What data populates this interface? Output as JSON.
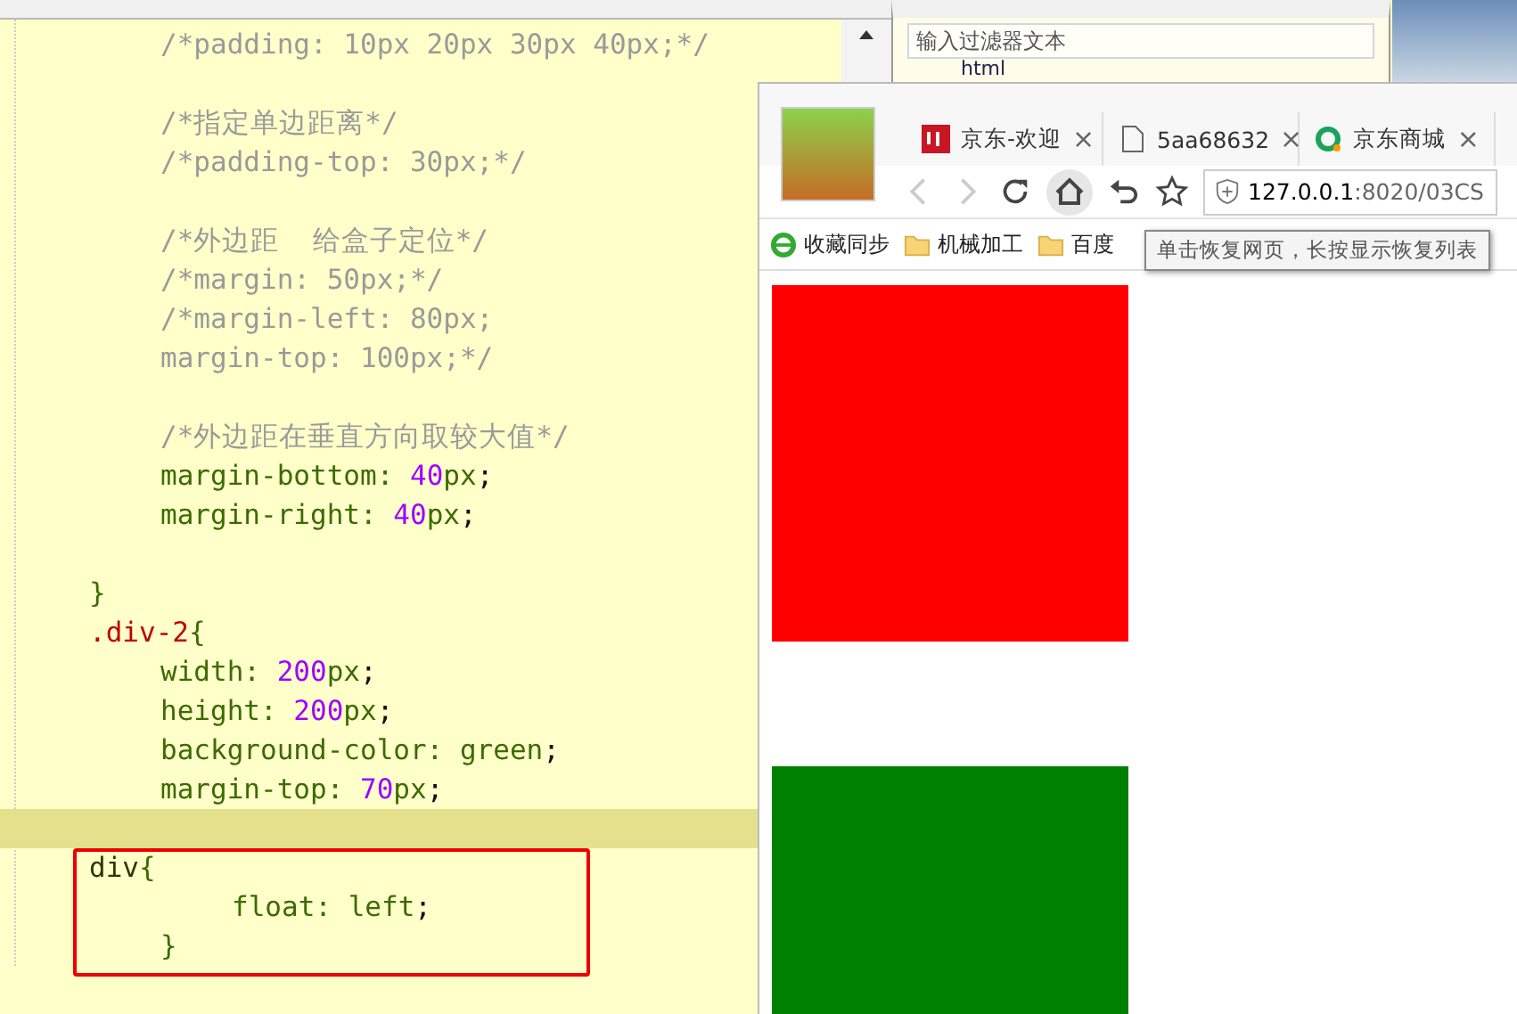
{
  "editor": {
    "lines": [
      {
        "kind": "inner",
        "tokens": [
          {
            "kind": "comment",
            "text": "/*padding: 10px 20px 30px 40px;*/"
          }
        ]
      },
      {
        "kind": "blank"
      },
      {
        "kind": "inner",
        "tokens": [
          {
            "kind": "comment",
            "text": "/*指定单边距离*/"
          }
        ]
      },
      {
        "kind": "inner",
        "tokens": [
          {
            "kind": "comment",
            "text": "/*padding-top: 30px;*/"
          }
        ]
      },
      {
        "kind": "blank"
      },
      {
        "kind": "inner",
        "tokens": [
          {
            "kind": "comment",
            "text": "/*外边距  给盒子定位*/"
          }
        ]
      },
      {
        "kind": "inner",
        "tokens": [
          {
            "kind": "comment",
            "text": "/*margin: 50px;*/"
          }
        ]
      },
      {
        "kind": "inner",
        "tokens": [
          {
            "kind": "comment",
            "text": "/*margin-left: 80px;"
          }
        ]
      },
      {
        "kind": "inner",
        "tokens": [
          {
            "kind": "comment",
            "text": "margin-top: 100px;*/"
          }
        ]
      },
      {
        "kind": "blank"
      },
      {
        "kind": "inner",
        "tokens": [
          {
            "kind": "comment",
            "text": "/*外边距在垂直方向取较大值*/"
          }
        ]
      },
      {
        "kind": "inner",
        "tokens": [
          {
            "kind": "property",
            "text": "margin-bottom: "
          },
          {
            "kind": "number",
            "text": "40"
          },
          {
            "kind": "property",
            "text": "px"
          },
          {
            "kind": "punct",
            "text": ";"
          }
        ]
      },
      {
        "kind": "inner",
        "tokens": [
          {
            "kind": "property",
            "text": "margin-right: "
          },
          {
            "kind": "number",
            "text": "40"
          },
          {
            "kind": "property",
            "text": "px"
          },
          {
            "kind": "punct",
            "text": ";"
          }
        ]
      },
      {
        "kind": "blank"
      },
      {
        "kind": "outer",
        "tokens": [
          {
            "kind": "brace",
            "text": "}"
          }
        ]
      },
      {
        "kind": "outer",
        "tokens": [
          {
            "kind": "selector",
            "text": ".div-2"
          },
          {
            "kind": "brace",
            "text": "{"
          }
        ]
      },
      {
        "kind": "inner",
        "tokens": [
          {
            "kind": "property",
            "text": "width: "
          },
          {
            "kind": "number",
            "text": "200"
          },
          {
            "kind": "property",
            "text": "px"
          },
          {
            "kind": "punct",
            "text": ";"
          }
        ]
      },
      {
        "kind": "inner",
        "tokens": [
          {
            "kind": "property",
            "text": "height: "
          },
          {
            "kind": "number",
            "text": "200"
          },
          {
            "kind": "property",
            "text": "px"
          },
          {
            "kind": "punct",
            "text": ";"
          }
        ]
      },
      {
        "kind": "inner",
        "tokens": [
          {
            "kind": "property",
            "text": "background-color: green"
          },
          {
            "kind": "punct",
            "text": ";"
          }
        ]
      },
      {
        "kind": "inner",
        "tokens": [
          {
            "kind": "property",
            "text": "margin-top: "
          },
          {
            "kind": "number",
            "text": "70"
          },
          {
            "kind": "property",
            "text": "px"
          },
          {
            "kind": "punct",
            "text": ";"
          }
        ]
      },
      {
        "kind": "cursor"
      },
      {
        "kind": "outer",
        "tokens": [
          {
            "kind": "tag",
            "text": "div"
          },
          {
            "kind": "brace",
            "text": "{"
          }
        ]
      },
      {
        "kind": "nested",
        "tokens": [
          {
            "kind": "property",
            "text": "float: left"
          },
          {
            "kind": "punct",
            "text": ";"
          }
        ]
      },
      {
        "kind": "inner",
        "tokens": [
          {
            "kind": "brace",
            "text": "}"
          }
        ]
      }
    ]
  },
  "outline": {
    "filter": {
      "placeholder": "输入过滤器文本"
    },
    "item": "html"
  },
  "browser": {
    "tabs": [
      {
        "kind": "jd",
        "label": "京东-欢迎",
        "close": "×"
      },
      {
        "kind": "page",
        "label": "5aa68632",
        "close": "×"
      },
      {
        "kind": "ring",
        "label": "京东商城",
        "close": "×"
      }
    ],
    "address": {
      "host": "127.0.0.1",
      "rest": ":8020/03CS"
    },
    "bookmarks": [
      {
        "kind": "sync",
        "label": "收藏同步"
      },
      {
        "kind": "folder",
        "label": "机械加工"
      },
      {
        "kind": "folder",
        "label": "百度"
      }
    ],
    "tooltip": "单击恢复网页，长按显示恢复列表",
    "boxes": [
      {
        "color": "#ff0000"
      },
      {
        "color": "#008000"
      }
    ]
  }
}
